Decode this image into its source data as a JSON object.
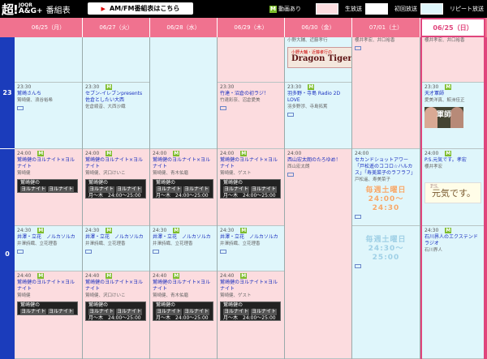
{
  "app": {
    "logo_main": "超!",
    "logo_top": "JOQR",
    "logo_bottom": "A&G+",
    "title": "番組表",
    "amfm_arrow": "▶",
    "amfm_label": "AM/FM番組表はこちら"
  },
  "legend": {
    "video_mark": "M",
    "video": "動画あり",
    "live": "生放送",
    "first": "初回放送",
    "repeat": "リピート放送"
  },
  "days": [
    "06/25（月）",
    "06/27（火）",
    "06/28（水）",
    "06/29（木）",
    "06/30（金）",
    "07/01（土）",
    "06/25（日）"
  ],
  "hours": {
    "h23": "23",
    "h0": "0"
  },
  "mark": "M",
  "cols": {
    "mon": {
      "s1": {
        "time": "23:30",
        "title": "鷲崎さんち",
        "cast": "鷲崎健、浪谷裕希"
      },
      "s2": {
        "time": "24:00",
        "title": "鷲崎健のヨルナイト×ヨルナイト",
        "cast": "鷲崎健",
        "ban1": "鷲崎健の",
        "ban2a": "ヨルナイト",
        "ban2b": "ヨルナイト"
      },
      "s3": {
        "time": "24:30",
        "title": "井澤・立花　ノルカソルカ",
        "cast": "井澤詩織、立花理香"
      },
      "s4": {
        "time": "24:40",
        "title": "鷲崎健のヨルナイト×ヨルナイト",
        "cast": "鷲崎健",
        "ban1": "鷲崎健の",
        "ban2a": "ヨルナイト",
        "ban2b": "ヨルナイト"
      }
    },
    "tue": {
      "s1": {
        "time": "23:30",
        "title": "セブン-イレブンpresents佐倉としたい大西",
        "cast": "佐倉綾音、大西沙織"
      },
      "s2": {
        "time": "24:00",
        "title": "鷲崎健のヨルナイト×ヨルナイト",
        "cast": "鷲崎健、沢口けいこ",
        "ban1": "鷲崎健の",
        "ban2a": "ヨルナイト",
        "ban2b": "ヨルナイト",
        "ban3": "月～木　24:00～25:00"
      },
      "s3": {
        "time": "24:30",
        "title": "井澤・立花　ノルカソルカ",
        "cast": "井澤詩織、立花理香"
      },
      "s4": {
        "time": "24:40",
        "title": "鷲崎健のヨルナイト×ヨルナイト",
        "cast": "鷲崎健、沢口けいこ",
        "ban1": "鷲崎健の",
        "ban2a": "ヨルナイト",
        "ban2b": "ヨルナイト",
        "ban3": "月～木　24:00～25:00"
      }
    },
    "wed": {
      "s2": {
        "time": "24:00",
        "title": "鷲崎健のヨルナイト×ヨルナイト",
        "cast": "鷲崎健、青木佑磨",
        "ban1": "鷲崎健の",
        "ban2a": "ヨルナイト",
        "ban2b": "ヨルナイト",
        "ban3": "月～木　24:00～25:00"
      },
      "s3": {
        "time": "24:30",
        "title": "井澤・立花　ノルカソルカ",
        "cast": "井澤詩織、立花理香"
      },
      "s4": {
        "time": "24:40",
        "title": "鷲崎健のヨルナイト×ヨルナイト",
        "cast": "鷲崎健、青木佑磨",
        "ban1": "鷲崎健の",
        "ban2a": "ヨルナイト",
        "ban2b": "ヨルナイト",
        "ban3": "月～木　24:00～25:00"
      }
    },
    "thu": {
      "s1": {
        "time": "23:30",
        "title": "竹達・沼倉の初ラジ！",
        "cast": "竹達彩奈、沼倉愛美"
      },
      "s2": {
        "time": "24:00",
        "title": "鷲崎健のヨルナイト×ヨルナイト",
        "cast": "鷲崎健、ゲスト",
        "ban1": "鷲崎健の",
        "ban2a": "ヨルナイト",
        "ban2b": "ヨルナイト",
        "ban3": "月～木　24:00～25:00"
      },
      "s3": {
        "time": "24:30",
        "title": "井澤・立花　ノルカソルカ",
        "cast": "井澤詩織、立花理香"
      },
      "s4": {
        "time": "24:40",
        "title": "鷲崎健のヨルナイト×ヨルナイト",
        "cast": "鷲崎健、ゲスト",
        "ban1": "鷲崎健の",
        "ban2a": "ヨルナイト",
        "ban2b": "ヨルナイト",
        "ban3": "月～木　24:00～25:00"
      }
    },
    "fri": {
      "s0": {
        "cast": "小野大輔、近藤孝行",
        "d1": "小野大輔・近藤孝行の",
        "d2": "Dragon Tiger"
      },
      "s1": {
        "time": "23:30",
        "title": "羽多野・寺島 Radio 2D LOVE",
        "cast": "羽多野渉、寺島拓篤"
      },
      "s2": {
        "time": "24:00",
        "title": "西山宏太朗のたろゆめ！",
        "cast": "西山宏太朗"
      }
    },
    "sat": {
      "s0": {
        "cast": "櫻井孝宏、井口裕香"
      },
      "s2": {
        "time": "24:00",
        "title": "セカンドショットアワー「戸松遥のココロ☆ハルカス」「寿美菜子のラフラフ」",
        "cast": "戸松遥、寿美菜子",
        "o1": "毎週土曜日",
        "o2": "24:00～24:30"
      },
      "s3": {
        "o1": "毎週土曜日",
        "o2": "24:30～25:00"
      }
    },
    "sun": {
      "s0": {
        "cast": "櫻井孝宏、井口裕香"
      },
      "s1": {
        "time": "23:30",
        "title": "天才軍師",
        "cast": "愛美洋真、鮫洲佳正",
        "photo": "軍師"
      },
      "s2": {
        "time": "24:00",
        "title": "P.S.元気です。孝宏",
        "cast": "櫻井孝宏",
        "ps1": "P.S.",
        "ps2": "元気です。"
      },
      "s3": {
        "time": "24:30",
        "title": "石川界人のエクステンドラジオ",
        "cast": "石川界人"
      }
    }
  }
}
